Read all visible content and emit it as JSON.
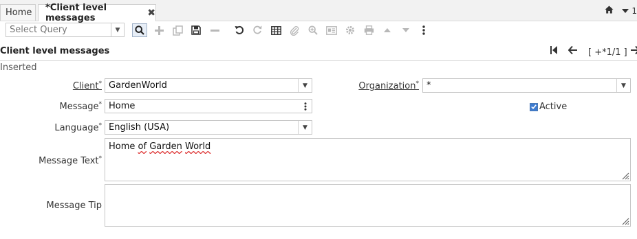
{
  "tabs": {
    "home_label": "Home",
    "active_label": "*Client level messages",
    "close_glyph": "✖",
    "window_count": "1"
  },
  "toolbar": {
    "query_placeholder": "Select Query"
  },
  "header": {
    "title": "Client level messages",
    "record_nav": "[ +*1/1 ]",
    "status": "Inserted"
  },
  "form": {
    "client_label": "Client",
    "client_value": "GardenWorld",
    "organization_label": "Organization",
    "organization_value": "*",
    "message_label": "Message",
    "message_value": "Home",
    "active_label": "Active",
    "active_checked": true,
    "language_label": "Language",
    "language_value": "English (USA)",
    "message_text_label": "Message Text",
    "message_text_words": [
      "Home",
      "of",
      "Garden",
      "World"
    ],
    "message_tip_label": "Message Tip",
    "message_tip_value": "",
    "required_mark": "*"
  },
  "colors": {
    "accent": "#3d7bd0",
    "disabled_icon": "#b8b8b8",
    "enabled_icon": "#333333"
  }
}
